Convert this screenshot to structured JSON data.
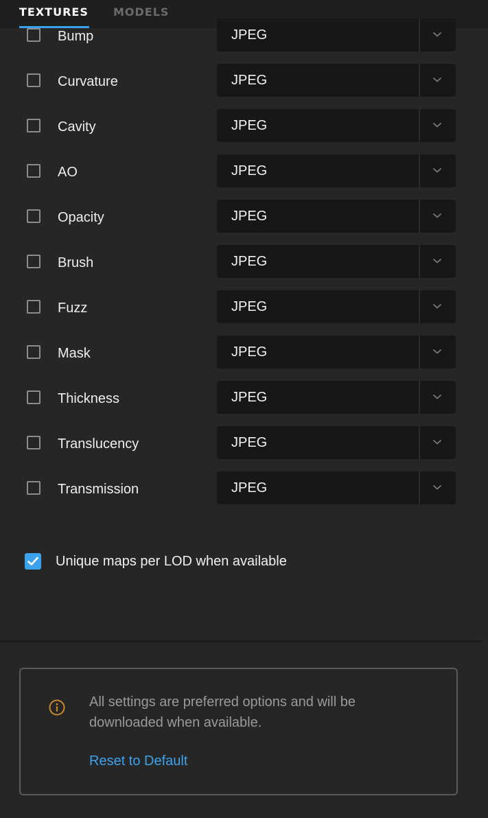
{
  "tabs": [
    {
      "label": "TEXTURES",
      "active": true
    },
    {
      "label": "MODELS",
      "active": false
    }
  ],
  "rows": [
    {
      "label": "Bump",
      "checked": false,
      "format": "JPEG"
    },
    {
      "label": "Curvature",
      "checked": false,
      "format": "JPEG"
    },
    {
      "label": "Cavity",
      "checked": false,
      "format": "JPEG"
    },
    {
      "label": "AO",
      "checked": false,
      "format": "JPEG"
    },
    {
      "label": "Opacity",
      "checked": false,
      "format": "JPEG"
    },
    {
      "label": "Brush",
      "checked": false,
      "format": "JPEG"
    },
    {
      "label": "Fuzz",
      "checked": false,
      "format": "JPEG"
    },
    {
      "label": "Mask",
      "checked": false,
      "format": "JPEG"
    },
    {
      "label": "Thickness",
      "checked": false,
      "format": "JPEG"
    },
    {
      "label": "Translucency",
      "checked": false,
      "format": "JPEG"
    },
    {
      "label": "Transmission",
      "checked": false,
      "format": "JPEG"
    }
  ],
  "lod_option": {
    "label": "Unique maps per LOD when available",
    "checked": true
  },
  "info": {
    "icon": "info-icon",
    "text": "All settings are preferred options and will be downloaded when available.",
    "reset_label": "Reset to Default"
  },
  "colors": {
    "accent": "#3da2ee",
    "background": "#262626",
    "select_background": "#171717",
    "info_icon": "#c68a2e"
  }
}
